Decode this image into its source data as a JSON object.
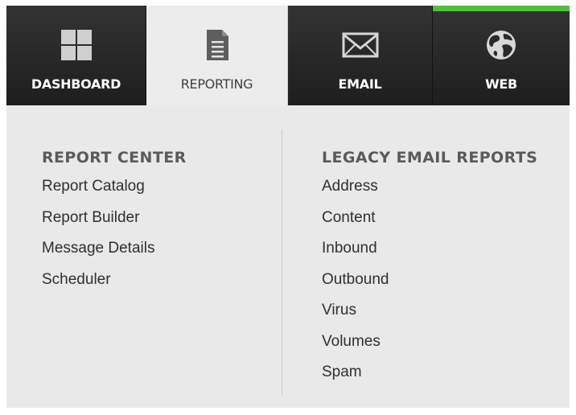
{
  "tabs": {
    "dashboard": {
      "label": "DASHBOARD",
      "icon": "grid-icon"
    },
    "reporting": {
      "label": "REPORTING",
      "icon": "document-icon",
      "active": true
    },
    "email": {
      "label": "EMAIL",
      "icon": "envelope-icon"
    },
    "web": {
      "label": "WEB",
      "icon": "globe-icon",
      "accent_color": "#4fbf3c"
    }
  },
  "menu": {
    "report_center": {
      "heading": "REPORT CENTER",
      "items": [
        "Report Catalog",
        "Report Builder",
        "Message Details",
        "Scheduler"
      ]
    },
    "legacy_email_reports": {
      "heading": "LEGACY EMAIL REPORTS",
      "items": [
        "Address",
        "Content",
        "Inbound",
        "Outbound",
        "Virus",
        "Volumes",
        "Spam"
      ]
    }
  },
  "colors": {
    "active_tab_bg": "#ececec",
    "tab_bg": "#262626",
    "menu_bg": "#e9e9e9",
    "accent": "#4fbf3c"
  }
}
